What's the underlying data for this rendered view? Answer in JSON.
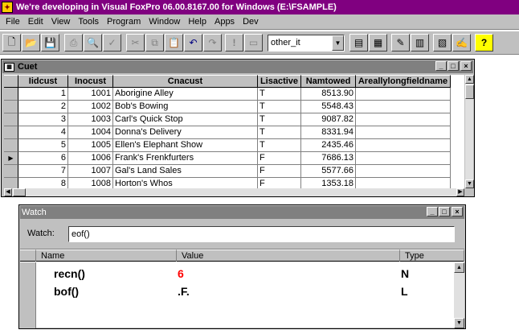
{
  "window": {
    "title": "We're developing in Visual FoxPro 06.00.8167.00 for Windows  (E:\\FSAMPLE)"
  },
  "menu": {
    "items": [
      "File",
      "Edit",
      "View",
      "Tools",
      "Program",
      "Window",
      "Help",
      "Apps",
      "Dev"
    ]
  },
  "toolbar": {
    "combo_value": "other_it"
  },
  "browse": {
    "title": "Cuet",
    "columns": [
      "Iidcust",
      "Inocust",
      "Cnacust",
      "Lisactive",
      "Namtowed",
      "Areallylongfieldname"
    ],
    "rows": [
      {
        "iidcust": "1",
        "inocust": "1001",
        "cnacust": "Aborigine Alley",
        "lisactive": "T",
        "namtowed": "8513.90",
        "areally": ""
      },
      {
        "iidcust": "2",
        "inocust": "1002",
        "cnacust": "Bob's Bowing",
        "lisactive": "T",
        "namtowed": "5548.43",
        "areally": ""
      },
      {
        "iidcust": "3",
        "inocust": "1003",
        "cnacust": "Carl's Quick Stop",
        "lisactive": "T",
        "namtowed": "9087.82",
        "areally": ""
      },
      {
        "iidcust": "4",
        "inocust": "1004",
        "cnacust": "Donna's Delivery",
        "lisactive": "T",
        "namtowed": "8331.94",
        "areally": ""
      },
      {
        "iidcust": "5",
        "inocust": "1005",
        "cnacust": "Ellen's Elephant Show",
        "lisactive": "T",
        "namtowed": "2435.46",
        "areally": ""
      },
      {
        "iidcust": "6",
        "inocust": "1006",
        "cnacust": "Frank's Frenkfurters",
        "lisactive": "F",
        "namtowed": "7686.13",
        "areally": ""
      },
      {
        "iidcust": "7",
        "inocust": "1007",
        "cnacust": "Gal's Land Sales",
        "lisactive": "F",
        "namtowed": "5577.66",
        "areally": ""
      },
      {
        "iidcust": "8",
        "inocust": "1008",
        "cnacust": "Horton's Whos",
        "lisactive": "F",
        "namtowed": "1353.18",
        "areally": ""
      }
    ],
    "current_row": 6
  },
  "watch": {
    "title": "Watch",
    "label": "Watch:",
    "input_value": "eof()",
    "columns": {
      "name": "Name",
      "value": "Value",
      "type": "Type"
    },
    "rows": [
      {
        "name": "recn()",
        "value": "6",
        "type": "N",
        "value_color": "#ff0000"
      },
      {
        "name": "bof()",
        "value": ".F.",
        "type": "L",
        "value_color": "#000000"
      }
    ]
  },
  "colors": {
    "titlebar": "#800080",
    "chrome": "#c0c0c0"
  }
}
